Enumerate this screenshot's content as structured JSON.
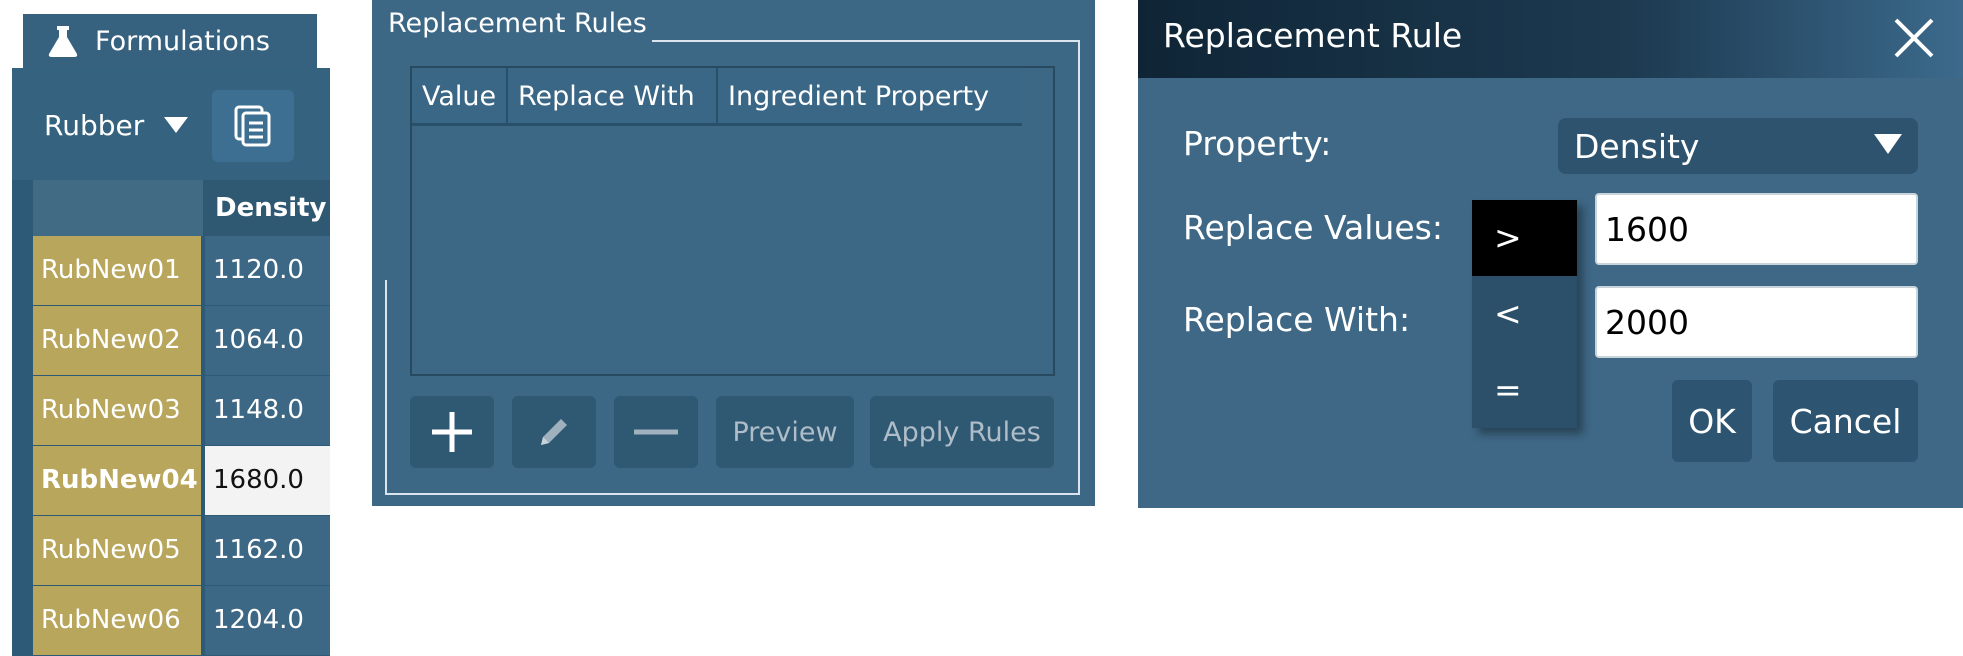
{
  "formulations": {
    "tab_label": "Formulations",
    "tab_icon": "flask-icon",
    "dropdown_value": "Rubber",
    "copy_icon": "copy-icon",
    "column_header": "Density",
    "rows": [
      {
        "name": "RubNew01",
        "value": "1120.0"
      },
      {
        "name": "RubNew02",
        "value": "1064.0"
      },
      {
        "name": "RubNew03",
        "value": "1148.0"
      },
      {
        "name": "RubNew04",
        "value": "1680.0"
      },
      {
        "name": "RubNew05",
        "value": "1162.0"
      },
      {
        "name": "RubNew06",
        "value": "1204.0"
      }
    ],
    "selected_row": "RubNew04",
    "colors": {
      "name_cell": "#b8a65c",
      "value_cell": "#3d6885",
      "selected_value_cell": "#f3f3f3"
    }
  },
  "replacement_rules": {
    "title": "Replacement Rules",
    "columns": [
      "Value",
      "Replace With",
      "Ingredient Property"
    ],
    "buttons": {
      "add_icon": "plus-icon",
      "edit_icon": "pencil-icon",
      "remove_icon": "minus-icon",
      "preview": "Preview",
      "apply": "Apply Rules"
    }
  },
  "dialog": {
    "title": "Replacement Rule",
    "close_icon": "close-icon",
    "property_label": "Property:",
    "property_value": "Density",
    "replace_values_label": "Replace Values:",
    "replace_values_input": "1600",
    "replace_with_label": "Replace With:",
    "replace_with_input": "2000",
    "operators": [
      ">",
      "<",
      "="
    ],
    "selected_operator": ">",
    "ok": "OK",
    "cancel": "Cancel"
  }
}
